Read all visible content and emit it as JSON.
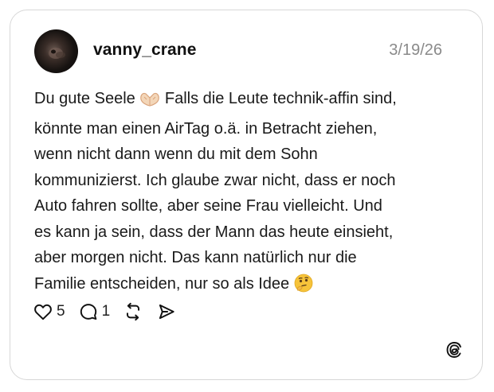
{
  "post": {
    "username": "vanny_crane",
    "date": "3/19/26",
    "text_lines": [
      "Du gute Seele",
      "Falls die Leute technik-affin sind,",
      "könnte man einen AirTag o.ä. in Betracht ziehen,",
      "wenn nicht dann wenn du mit dem Sohn",
      "kommunizierst. Ich glaube zwar nicht, dass er noch",
      "Auto fahren sollte, aber seine Frau vielleicht. Und",
      "es kann ja sein, dass der Mann das heute einsieht,",
      "aber morgen nicht. Das kann natürlich nur die",
      "Familie entscheiden, nur so als Idee"
    ],
    "emojis": [
      "heart-hands-emoji",
      "thinking-face-emoji"
    ],
    "likes": "5",
    "replies": "1"
  },
  "colors": {
    "text": "#1a1a1a",
    "date": "#8a8a8a",
    "border": "#d7d7d7",
    "emoji_yellow": "#f6c33a"
  },
  "icons": [
    "heart-icon",
    "comment-icon",
    "repost-icon",
    "share-icon",
    "threads-logo-icon"
  ]
}
